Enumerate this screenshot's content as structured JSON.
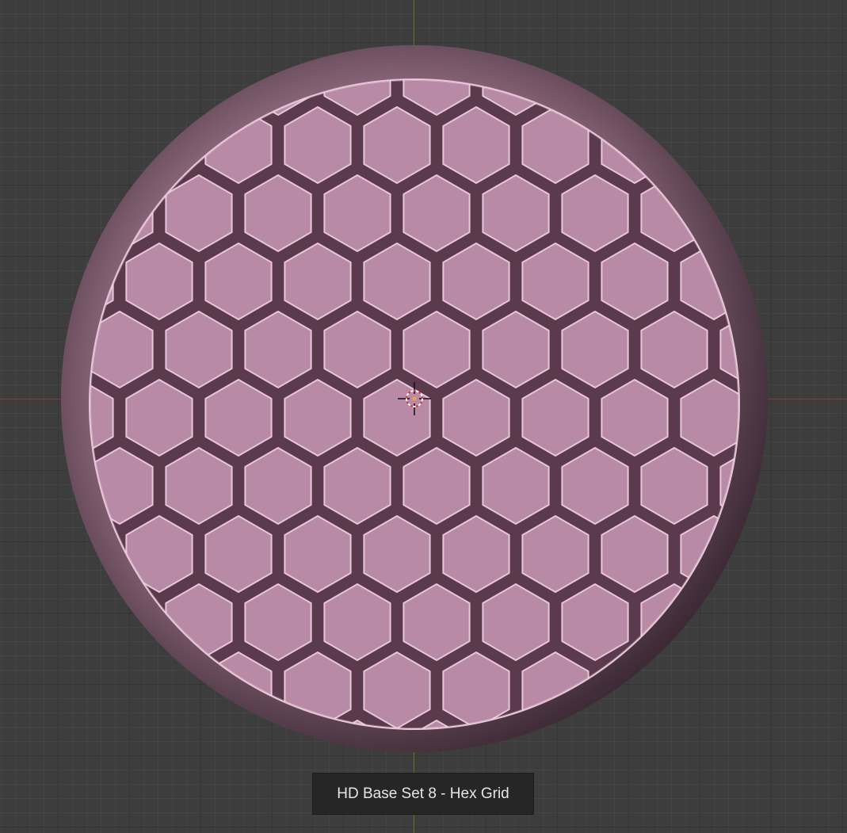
{
  "caption": "HD Base Set 8 - Hex Grid",
  "colors": {
    "viewport_bg": "#3d3d3d",
    "axis_x": "#8a3b3b",
    "axis_y": "#5f7f2b",
    "base_rim": "#8a6478",
    "hex_tile": "#b88aa5",
    "hex_gap": "#5a3a4c",
    "caption_bg": "#262626",
    "caption_text": "#e6e6e6"
  },
  "icons": {
    "cursor": "3d-cursor-icon"
  }
}
